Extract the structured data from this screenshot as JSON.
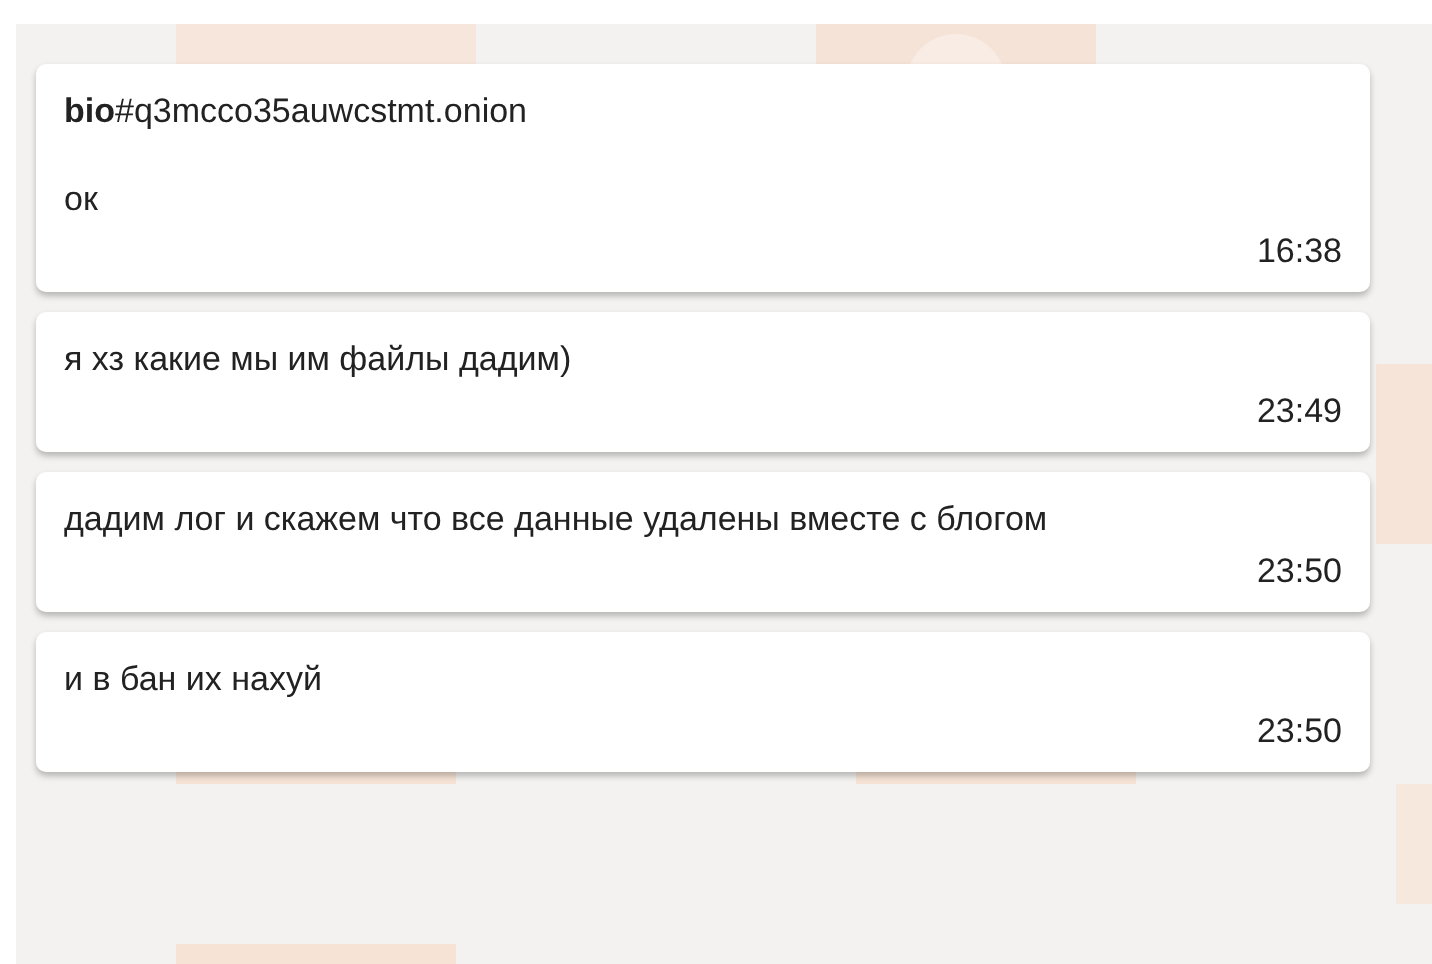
{
  "messages": [
    {
      "sender": "**bio**#q3mcco35auwcstmt.onion",
      "text": "ок",
      "time": "16:38"
    },
    {
      "text": "я хз какие мы им файлы дадим)",
      "time": "23:49"
    },
    {
      "text": "дадим лог и скажем что все данные удалены вместе с блогом",
      "time": "23:50"
    },
    {
      "text": "и в бан их нахуй",
      "time": "23:50"
    }
  ]
}
